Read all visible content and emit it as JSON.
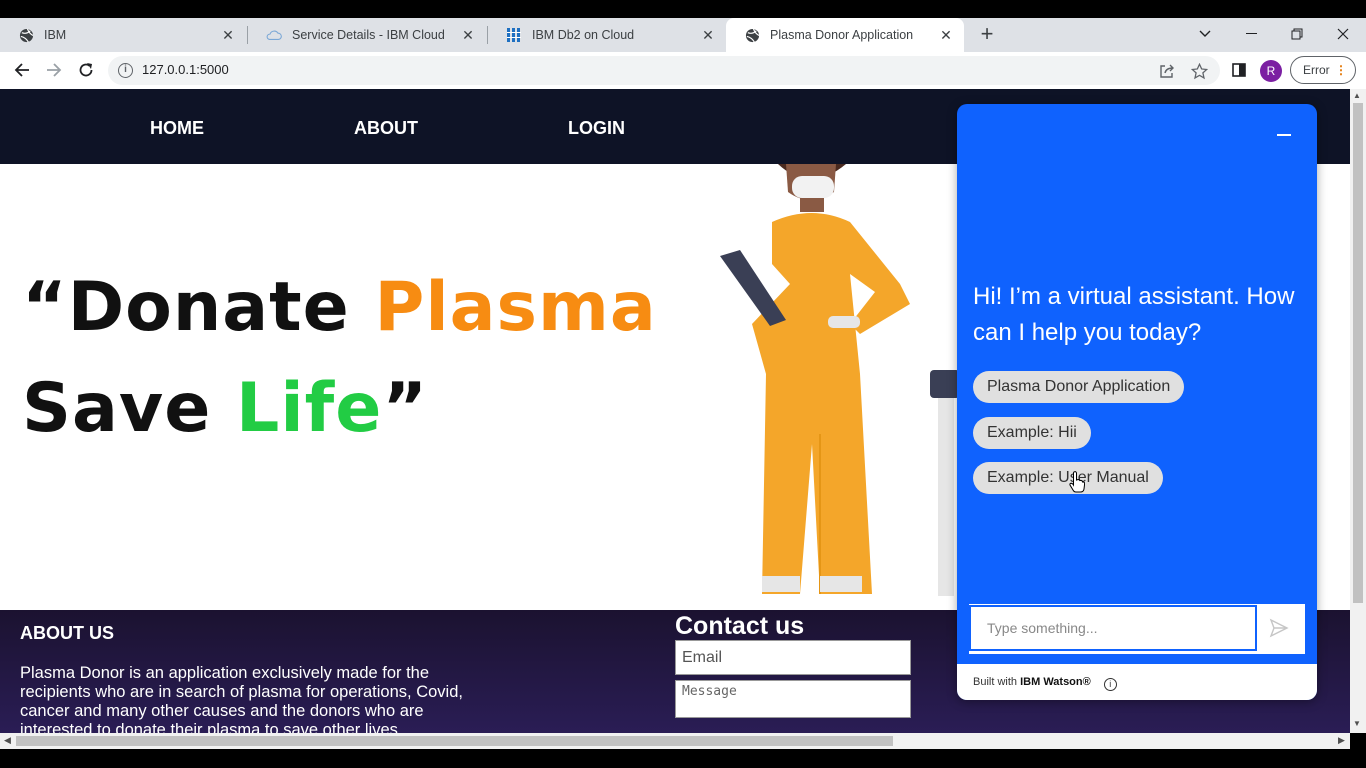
{
  "browser": {
    "tabs": [
      {
        "title": "IBM",
        "icon": "globe-icon"
      },
      {
        "title": "Service Details - IBM Cloud",
        "icon": "cloud-icon"
      },
      {
        "title": "IBM Db2 on Cloud",
        "icon": "db2-icon"
      },
      {
        "title": "Plasma Donor Application",
        "icon": "globe-icon",
        "active": true
      }
    ],
    "url": "127.0.0.1:5000",
    "profile_initial": "R",
    "error_label": "Error"
  },
  "nav": {
    "home": "HOME",
    "about": "ABOUT",
    "login": "LOGIN"
  },
  "hero": {
    "open_quote": "“",
    "word1": "Donate",
    "word2": "Plasma",
    "word3": "Save",
    "word4": "Life",
    "close_quote": "”",
    "carousel_dots": 3,
    "active_dot": 1
  },
  "about": {
    "heading": "ABOUT US",
    "text": "Plasma Donor is an application exclusively made for the recipients who are in search of plasma for operations, Covid, cancer and many other causes and the donors who are interested to donate their plasma to save other lives."
  },
  "contact": {
    "heading": "Contact us",
    "email_placeholder": "Email",
    "message_placeholder": "Message"
  },
  "chat": {
    "greeting": "Hi! I’m a virtual assistant. How can I help you today?",
    "options": [
      "Plasma Donor Application",
      "Example: Hii",
      "Example: User Manual"
    ],
    "input_placeholder": "Type something...",
    "footer_prefix": "Built with",
    "footer_brand": "IBM Watson®"
  },
  "colors": {
    "nav_bg": "#0e1326",
    "chat_blue": "#0f62fe",
    "accent_orange": "#f78c12",
    "accent_green": "#22cc44"
  }
}
